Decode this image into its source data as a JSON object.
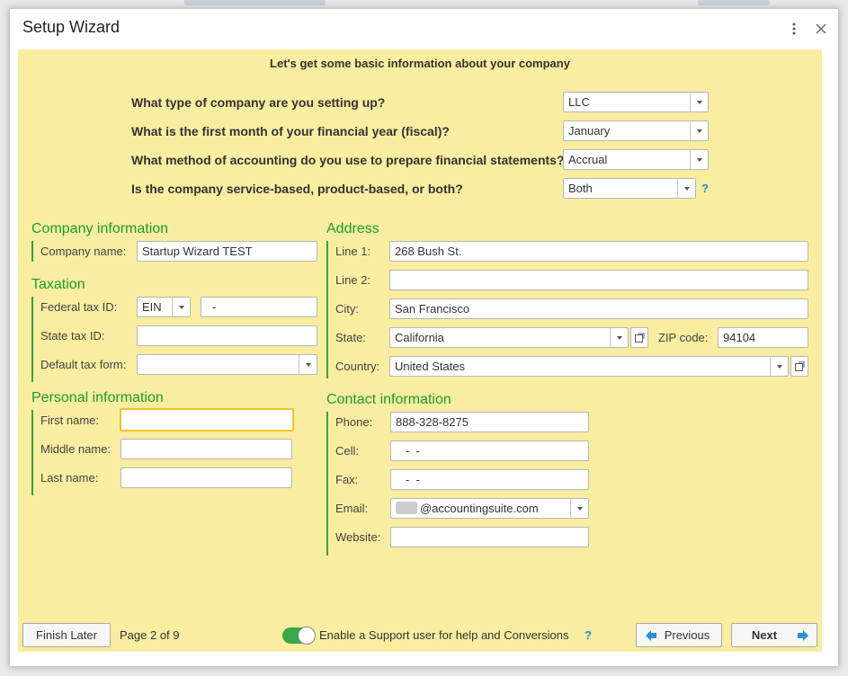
{
  "dialog": {
    "title": "Setup Wizard"
  },
  "heading": "Let's get some basic information about your company",
  "questions": [
    {
      "label": "What type of company are you setting up?",
      "value": "LLC"
    },
    {
      "label": "What is the first month of your financial year (fiscal)?",
      "value": "January"
    },
    {
      "label": "What method of accounting do you use to prepare financial statements?",
      "value": "Accrual"
    },
    {
      "label": "Is the company service-based, product-based, or both?",
      "value": "Both"
    }
  ],
  "help_glyph": "?",
  "company": {
    "title": "Company information",
    "name_label": "Company name:",
    "name_value": "Startup Wizard TEST"
  },
  "taxation": {
    "title": "Taxation",
    "federal_label": "Federal tax ID:",
    "federal_type": "EIN",
    "federal_value": "-",
    "state_label": "State tax ID:",
    "state_value": "",
    "form_label": "Default tax form:",
    "form_value": ""
  },
  "personal": {
    "title": "Personal information",
    "first_label": "First name:",
    "first_value": "",
    "middle_label": "Middle name:",
    "middle_value": "",
    "last_label": "Last name:",
    "last_value": ""
  },
  "address": {
    "title": "Address",
    "line1_label": "Line 1:",
    "line1_value": "268 Bush St.",
    "line2_label": "Line 2:",
    "line2_value": "",
    "city_label": "City:",
    "city_value": "San Francisco",
    "state_label": "State:",
    "state_value": "California",
    "zip_label": "ZIP code:",
    "zip_value": "94104",
    "country_label": "Country:",
    "country_value": "United States"
  },
  "contact": {
    "title": "Contact information",
    "phone_label": "Phone:",
    "phone_value": "888-328-8275",
    "cell_label": "Cell:",
    "cell_value": "-  -",
    "fax_label": "Fax:",
    "fax_value": "-  -",
    "email_label": "Email:",
    "email_value": "@accountingsuite.com",
    "website_label": "Website:",
    "website_value": ""
  },
  "footer": {
    "finish_later": "Finish Later",
    "page": "Page 2 of 9",
    "support_label": "Enable a Support user for help and Conversions",
    "previous": "Previous",
    "next": "Next"
  },
  "colors": {
    "panel": "#f8eda0",
    "section": "#1f9b2d",
    "accent_blue": "#1a8cd8",
    "toggle_on": "#3aa64a",
    "focus": "#f1c232"
  }
}
